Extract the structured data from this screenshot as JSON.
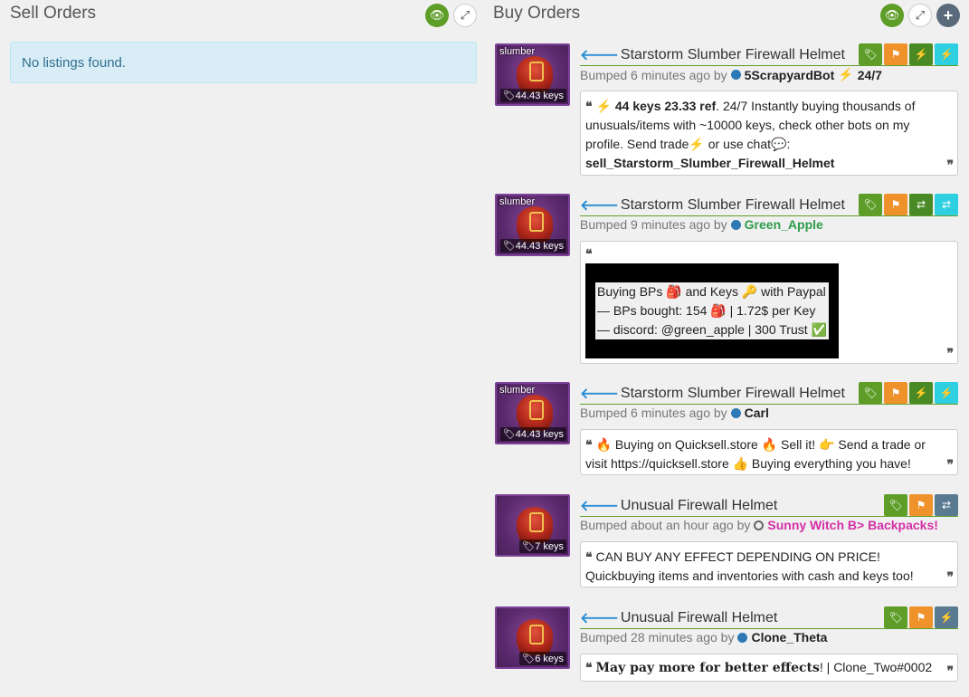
{
  "sell": {
    "title": "Sell Orders",
    "empty": "No listings found."
  },
  "buy": {
    "title": "Buy Orders"
  },
  "colors": {
    "accent_green": "#5e9e28",
    "tag_orange": "#f0922b",
    "tag_cyan": "#2ecfe0",
    "tag_slate": "#5a7a92",
    "username_link": "#2a8dd4",
    "info_bg": "#d9edf7"
  },
  "orders": [
    {
      "effect": "slumber",
      "price": "44.43 keys",
      "title": "Starstorm Slumber Firewall Helmet",
      "bumped": "Bumped 6 minutes ago by",
      "user": "5ScrapyardBot",
      "user_suffix": "24/7",
      "comment_bold": "44 keys 23.33 ref",
      "comment_text": ". 24/7 Instantly buying thousands of unusuals/items with ~10000 keys, check other bots on my profile. Send  trade",
      "comment_or": " or  use  chat",
      "comment_tail": ":",
      "comment_cmd": "sell_Starstorm_Slumber_Firewall_Helmet"
    },
    {
      "effect": "slumber",
      "price": "44.43 keys",
      "title": "Starstorm Slumber Firewall Helmet",
      "bumped": "Bumped 9 minutes ago by",
      "user": "Green_Apple",
      "lines": [
        "Buying BPs 🎒 and Keys 🔑 with Paypal",
        "— BPs bought: 154 🎒 | 1.72$ per Key",
        "— discord: @green_apple | 300 Trust ✅"
      ]
    },
    {
      "effect": "slumber",
      "price": "44.43 keys",
      "title": "Starstorm Slumber Firewall Helmet",
      "bumped": "Bumped 6 minutes ago by",
      "user": "Carl",
      "comment": "🔥 Buying on Quicksell.store 🔥  Sell it!  👉  Send a trade or visit https://quicksell.store  👍  Buying everything you have!"
    },
    {
      "price": "7 keys",
      "title": "Unusual Firewall Helmet",
      "bumped": "Bumped about an hour ago by",
      "user": "Sunny Witch B> Backpacks!",
      "comment": "CAN BUY ANY EFFECT DEPENDING ON PRICE! Quickbuying items and inventories with cash and keys too!"
    },
    {
      "price": "6 keys",
      "title": "Unusual Firewall Helmet",
      "bumped": "Bumped 28 minutes ago by",
      "user": "Clone_Theta",
      "comment_bold": "May pay more for better effects",
      "comment_tail": "! | Clone_Two#0002"
    }
  ]
}
